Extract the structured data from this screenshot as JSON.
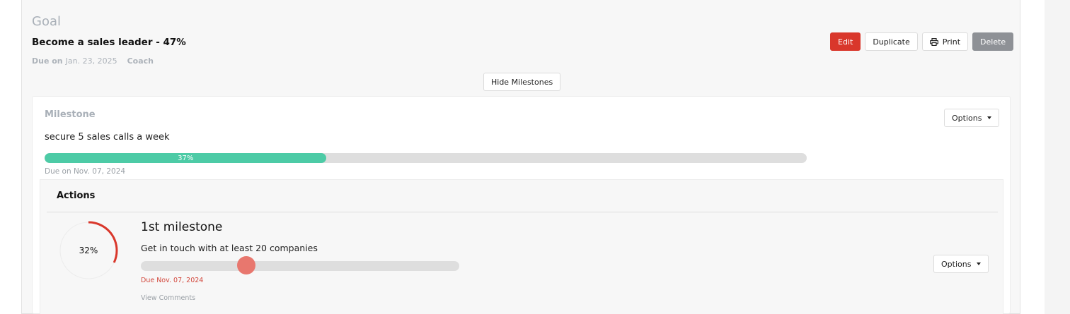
{
  "goal": {
    "heading": "Goal",
    "title": "Become a sales leader - 47%",
    "due_label": "Due on",
    "due_date": "Jan. 23, 2025",
    "role": "Coach"
  },
  "toolbar": {
    "edit_label": "Edit",
    "duplicate_label": "Duplicate",
    "print_label": "Print",
    "delete_label": "Delete",
    "print_icon": "printer-icon"
  },
  "hide_milestones_label": "Hide Milestones",
  "milestone": {
    "label": "Milestone",
    "text": "secure 5 sales calls a week",
    "progress_label": "37%",
    "progress": 37,
    "due": "Due on Nov. 07, 2024",
    "options_label": "Options"
  },
  "actions": {
    "title": "Actions",
    "item": {
      "percent_label": "32%",
      "percent": 32,
      "title": "1st milestone",
      "description": "Get in touch with at least 20 companies",
      "slider_value": 33,
      "due": "Due Nov. 07, 2024",
      "view_comments": "View Comments",
      "options_label": "Options"
    }
  },
  "colors": {
    "edit": "#d9372b",
    "delete": "#8e9196",
    "progress": "#4dcba6",
    "donut": "#d9372b",
    "slider_thumb": "#e8776e",
    "due_red": "#d2463b"
  }
}
